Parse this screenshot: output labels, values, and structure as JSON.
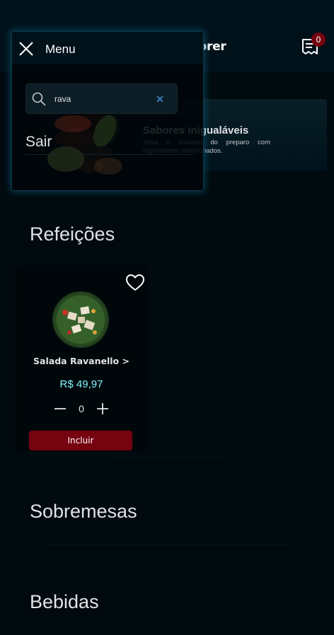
{
  "header": {
    "brand": "food explorer",
    "cart_count": "0",
    "receipt_icon": "receipt-icon"
  },
  "banner": {
    "title": "Sabores inigualáveis",
    "subtitle": "Sinta o cuidado do preparo com ingredientes selecionados."
  },
  "sections": {
    "meals": "Refeições",
    "desserts": "Sobremesas",
    "drinks": "Bebidas"
  },
  "card": {
    "name": "Salada Ravanello >",
    "price": "R$ 49,97",
    "quantity": "0",
    "include_label": "Incluir",
    "favorite_icon": "heart-icon"
  },
  "menu": {
    "title": "Menu",
    "search_value": "rava",
    "logout_label": "Sair",
    "close_icon": "close-icon"
  },
  "colors": {
    "background": "#000a0f",
    "header": "#00111a",
    "accent_red": "#750310",
    "price_cyan": "#82f3ff"
  }
}
